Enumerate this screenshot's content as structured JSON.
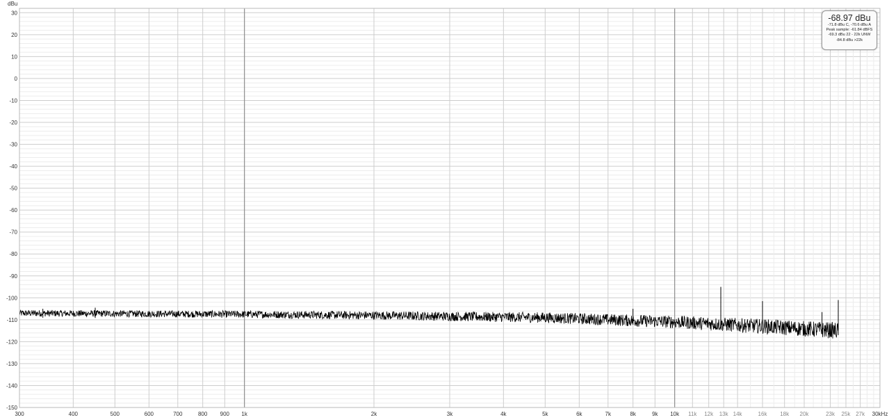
{
  "chart_data": {
    "type": "line",
    "title": "",
    "ylabel": "dBu",
    "xlabel": "",
    "x_scale": "log",
    "y_ticks": [
      30,
      20,
      10,
      0,
      -10,
      -20,
      -30,
      -40,
      -50,
      -60,
      -70,
      -80,
      -90,
      -100,
      -110,
      -120,
      -130,
      -140,
      -150
    ],
    "ylim": [
      -150,
      32
    ],
    "xlim": [
      300,
      30000
    ],
    "x_ticks": [
      {
        "value": 300,
        "label": "300"
      },
      {
        "value": 400,
        "label": "400"
      },
      {
        "value": 500,
        "label": "500"
      },
      {
        "value": 600,
        "label": "600"
      },
      {
        "value": 700,
        "label": "700"
      },
      {
        "value": 800,
        "label": "800"
      },
      {
        "value": 900,
        "label": "900"
      },
      {
        "value": 1000,
        "label": "1k"
      },
      {
        "value": 2000,
        "label": "2k"
      },
      {
        "value": 3000,
        "label": "3k"
      },
      {
        "value": 4000,
        "label": "4k"
      },
      {
        "value": 5000,
        "label": "5k"
      },
      {
        "value": 6000,
        "label": "6k"
      },
      {
        "value": 7000,
        "label": "7k"
      },
      {
        "value": 8000,
        "label": "8k"
      },
      {
        "value": 9000,
        "label": "9k"
      },
      {
        "value": 10000,
        "label": "10k"
      },
      {
        "value": 11000,
        "label": "11k"
      },
      {
        "value": 12000,
        "label": "12k"
      },
      {
        "value": 13000,
        "label": "13k"
      },
      {
        "value": 14000,
        "label": "14k"
      },
      {
        "value": 16000,
        "label": "16k"
      },
      {
        "value": 18000,
        "label": "18k"
      },
      {
        "value": 20000,
        "label": "20k"
      },
      {
        "value": 23000,
        "label": "23k"
      },
      {
        "value": 25000,
        "label": "25k"
      },
      {
        "value": 27000,
        "label": "27k"
      },
      {
        "value": 30000,
        "label": "30kHz"
      }
    ],
    "series": [
      {
        "color": "#000000",
        "x_start": 300,
        "x_end": 24000,
        "noise_floor": [
          {
            "x": 300,
            "y": -107
          },
          {
            "x": 1000,
            "y": -107.5
          },
          {
            "x": 2000,
            "y": -108
          },
          {
            "x": 5000,
            "y": -109
          },
          {
            "x": 10000,
            "y": -111
          },
          {
            "x": 16000,
            "y": -113
          },
          {
            "x": 24000,
            "y": -115
          }
        ],
        "spikes": [
          {
            "x": 340,
            "y": -105
          },
          {
            "x": 450,
            "y": -104.5
          },
          {
            "x": 8000,
            "y": -105
          },
          {
            "x": 12800,
            "y": -95
          },
          {
            "x": 16000,
            "y": -101.5
          },
          {
            "x": 22000,
            "y": -106.5
          },
          {
            "x": 24000,
            "y": -101
          }
        ]
      }
    ],
    "grid": true
  },
  "readout": {
    "value": "-68.97 dBu",
    "line1": "-71.8 dBu C, -70.6 dBu A",
    "line2": "Peak sample: -61.84 dBFS",
    "line3": "-69.3 dBu 22 - 22k UNW",
    "line4": "-84.8 dBu >22k"
  },
  "colors": {
    "grid_major": "#cdcdcd",
    "grid_minor": "#ececec",
    "grid_decade": "#8c8c8c",
    "trace": "#000000"
  }
}
